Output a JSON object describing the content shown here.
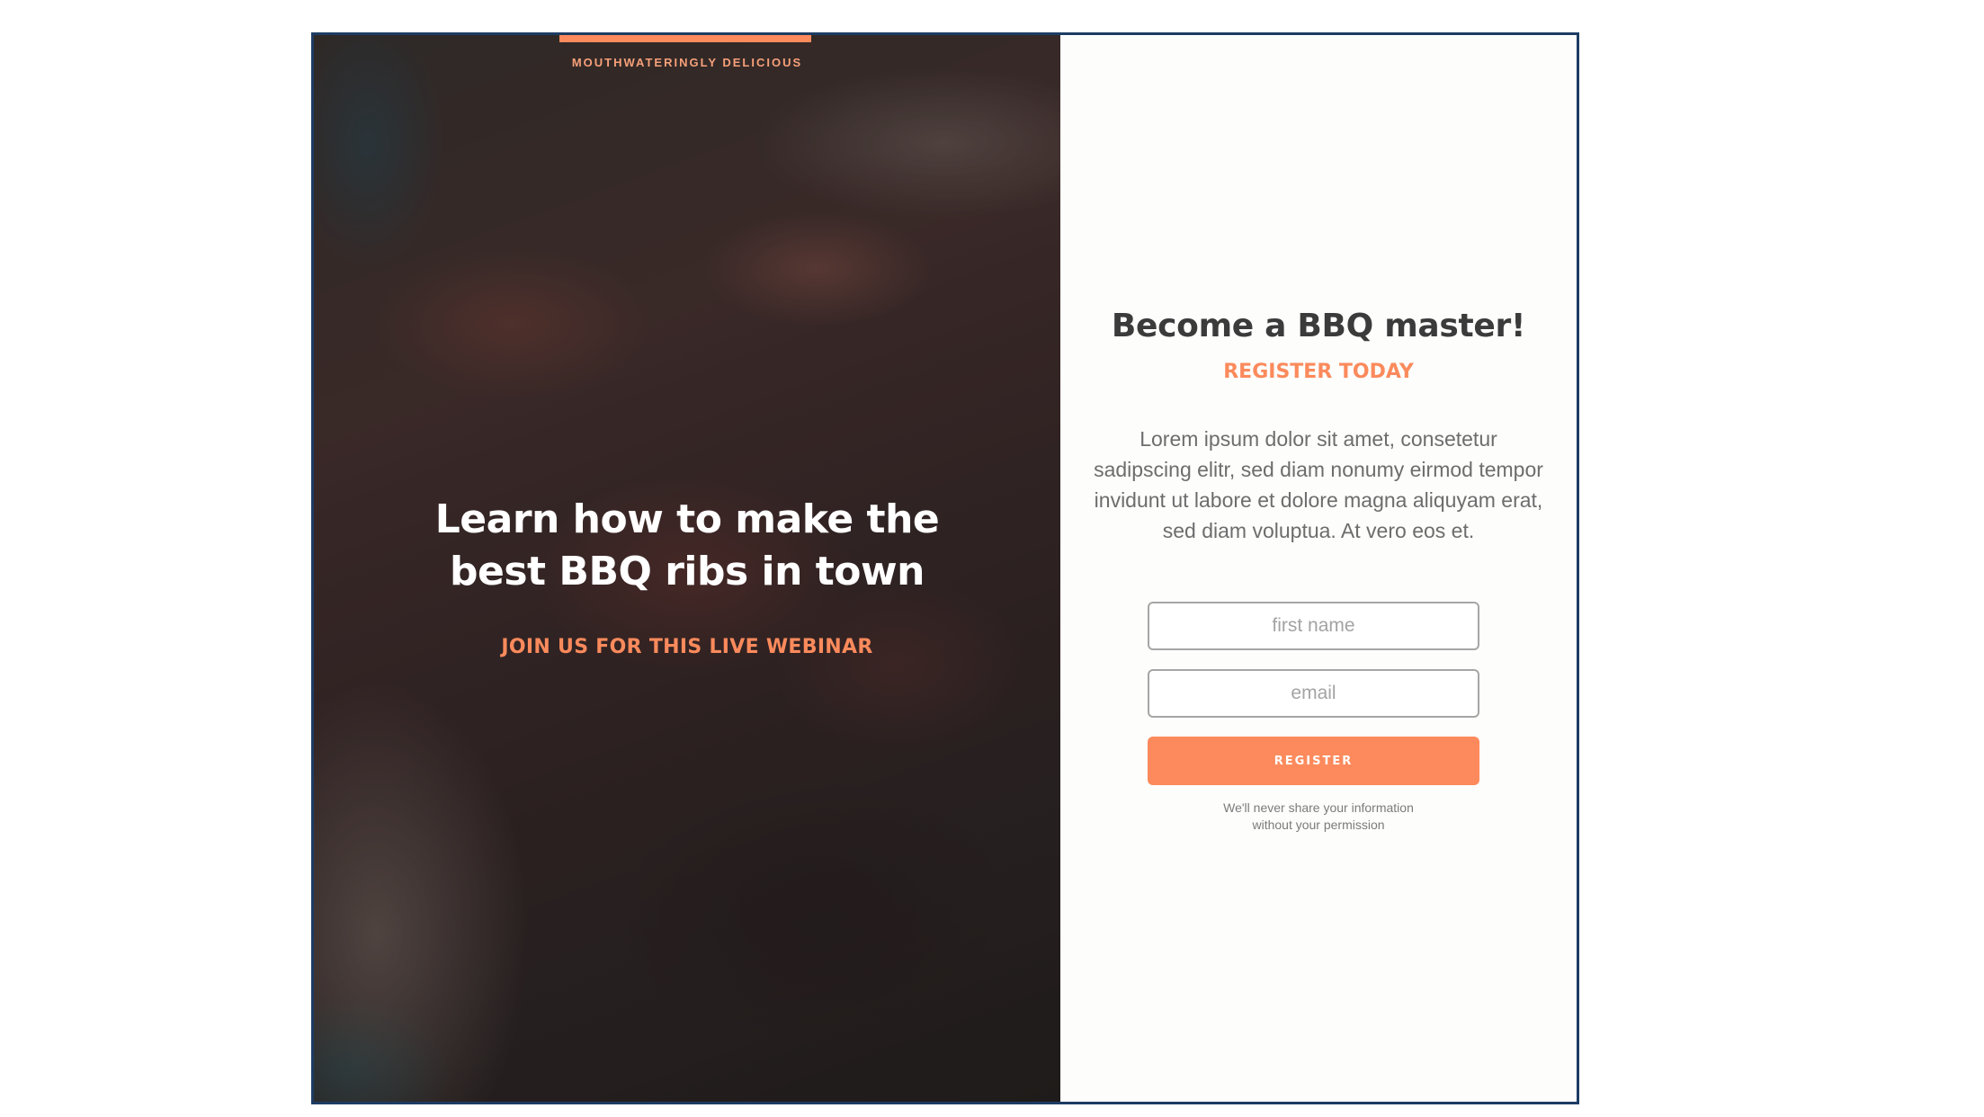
{
  "hero": {
    "kicker": "MOUTHWATERINGLY DELICIOUS",
    "headline_line1": "Learn how to make the",
    "headline_line2": "best BBQ ribs in town",
    "subheadline": "JOIN US FOR THIS LIVE WEBINAR",
    "background": "blurred-bbq-ribs-photo"
  },
  "form": {
    "title": "Become a BBQ master!",
    "subtitle": "REGISTER TODAY",
    "body": "Lorem ipsum dolor sit amet, consetetur sadipscing elitr, sed diam nonumy eirmod tempor invidunt ut labore et dolore magna aliquyam erat, sed diam voluptua. At vero eos et.",
    "first_name_placeholder": "first name",
    "email_placeholder": "email",
    "register_label": "REGISTER",
    "privacy_line1": "We'll never share your information",
    "privacy_line2": "without your permission"
  },
  "colors": {
    "accent": "#fb8a5c",
    "frame_border": "#1d3c63",
    "title_text": "#3b3b3b",
    "body_text": "#6d6d6d"
  }
}
